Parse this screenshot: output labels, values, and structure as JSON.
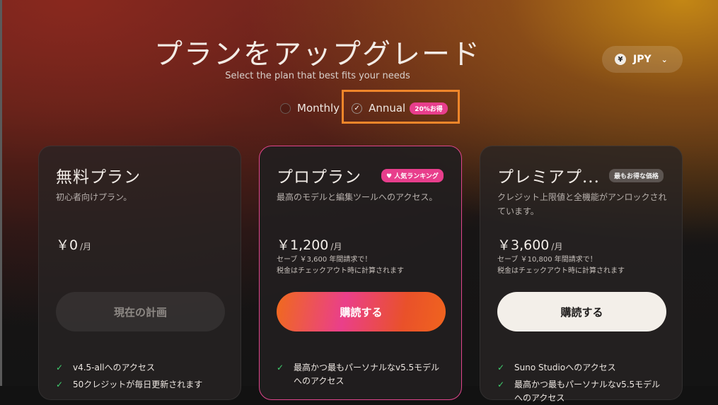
{
  "header": {
    "title": "プランをアップグレード",
    "subtitle": "Select the plan that best fits your needs"
  },
  "currency": {
    "symbol": "¥",
    "code": "JPY",
    "chevron": "⌄"
  },
  "billing": {
    "monthly_label": "Monthly",
    "annual_label": "Annual",
    "annual_badge": "20%お得",
    "selected": "annual"
  },
  "plans": [
    {
      "name": "無料プラン",
      "description": "初心者向けプラン。",
      "price": "￥0",
      "per": "/月",
      "button": "現在の計画",
      "features": [
        "v4.5-allへのアクセス",
        "50クレジットが毎日更新されます"
      ]
    },
    {
      "name": "プロプラン",
      "badge": "♥ 人気ランキング",
      "description": "最高のモデルと編集ツールへのアクセス。",
      "price": "￥1,200",
      "per": "/月",
      "savings": "セーブ ￥3,600 年間請求で！",
      "tax": "税金はチェックアウト時に計算されます",
      "button": "購読する",
      "features": [
        "最高かつ最もパーソナルなv5.5モデルへのアクセス"
      ]
    },
    {
      "name": "プレミアプ...",
      "badge": "最もお得な価格",
      "description": "クレジット上限値と全機能がアンロックされています。",
      "price": "￥3,600",
      "per": "/月",
      "savings": "セーブ ￥10,800 年間請求で！",
      "tax": "税金はチェックアウト時に計算されます",
      "button": "購読する",
      "features": [
        "Suno Studioへのアクセス",
        "最高かつ最もパーソナルなv5.5モデルへのアクセス"
      ]
    }
  ],
  "colors": {
    "accent_pink": "#e83e8c",
    "check_green": "#3fcf6e",
    "highlight_orange": "#f0862a"
  }
}
